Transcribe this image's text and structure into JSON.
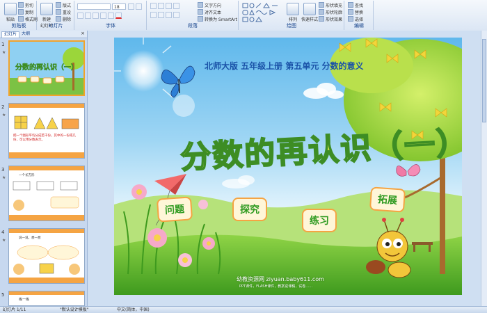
{
  "ribbon": {
    "groups": {
      "clipboard": {
        "label": "剪贴板",
        "paste": "粘贴",
        "cut": "剪切",
        "copy": "复制",
        "format_painter": "格式刷"
      },
      "slides": {
        "label": "幻灯片",
        "new_slide": "新建\n幻灯片",
        "layout": "版式",
        "reset": "重设",
        "delete": "删除"
      },
      "font": {
        "label": "字体",
        "font_size": "18"
      },
      "paragraph": {
        "label": "段落",
        "text_direction": "文字方向",
        "align_text": "对齐文本",
        "smartart": "转换为 SmartArt"
      },
      "drawing": {
        "label": "绘图",
        "arrange": "排列",
        "quick_styles": "快速样式",
        "shape_fill": "形状填充",
        "shape_outline": "形状轮廓",
        "shape_effects": "形状效果"
      },
      "editing": {
        "label": "编辑",
        "find": "查找",
        "replace": "替换",
        "select": "选择"
      }
    }
  },
  "panel": {
    "tabs": {
      "slides": "幻灯片",
      "outline": "大纲"
    },
    "close": "×",
    "thumbs": [
      {
        "num": "1",
        "title": "分数的再认识（一）"
      },
      {
        "num": "2",
        "text": "把一个图形平均分成若干份，其中的一份或几份，可以用分数表示。"
      },
      {
        "num": "3",
        "text": "一个长方形"
      },
      {
        "num": "4",
        "text": "说一说，想一想"
      },
      {
        "num": "5",
        "text": "练一练"
      }
    ]
  },
  "slide": {
    "subtitle": "北师大版  五年级上册  第五单元  分数的意义",
    "title": "分数的再认识（一）",
    "buttons": {
      "problem": "问题",
      "explore": "探究",
      "practice": "练习",
      "extend": "拓展"
    },
    "watermark": "幼教资源网 ziyuan.baby611.com",
    "watermark_sub": "PPT课件，FLASH课件，教案说课稿，试卷……"
  },
  "status": {
    "slide_of": "幻灯片 1/11",
    "theme": "\"默认设计模板\"",
    "language": "中文(简体，中国)"
  }
}
